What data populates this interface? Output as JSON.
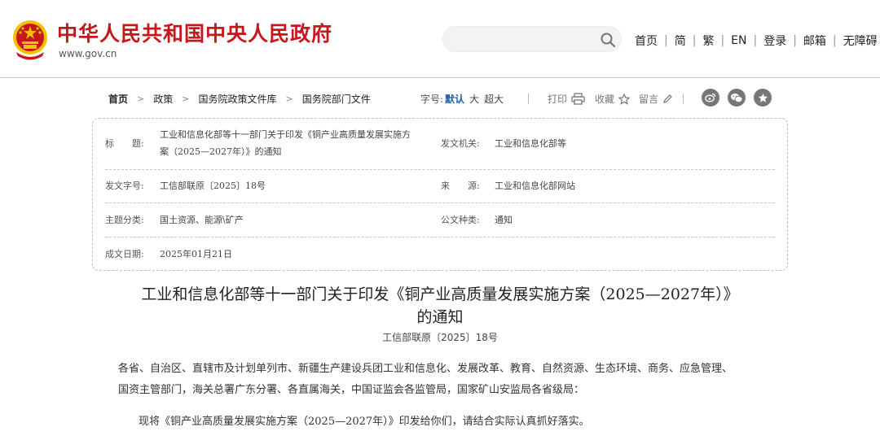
{
  "header": {
    "site_name": "中华人民共和国中央人民政府",
    "site_url": "www.gov.cn",
    "search": {
      "value": "",
      "placeholder": ""
    },
    "links": [
      "首页",
      "简",
      "繁",
      "EN",
      "登录",
      "邮箱",
      "无障碍"
    ]
  },
  "breadcrumb": [
    "首页",
    "政策",
    "国务院政策文件库",
    "国务院部门文件"
  ],
  "font_size": {
    "label": "字号:",
    "active": "默认",
    "options": [
      "大",
      "超大"
    ]
  },
  "tools": {
    "print": "打印",
    "favorite": "收藏",
    "comment": "留言"
  },
  "share_icons": [
    "weibo-icon",
    "wechat-icon",
    "star-icon"
  ],
  "info": {
    "title_label": "标　　题:",
    "title_value_line1": "工业和信息化部等十一部门关于印发《铜产业高质量发展实施方",
    "title_value_line2": "案（2025—2027年）》的通知",
    "issuer_label": "发文机关:",
    "issuer_value": "工业和信息化部等",
    "doc_no_label": "发文字号:",
    "doc_no_value": "工信部联原〔2025〕18号",
    "source_label": "来　　源:",
    "source_value": "工业和信息化部网站",
    "category_label": "主题分类:",
    "category_value": "国土资源、能源\\矿产",
    "doc_type_label": "公文种类:",
    "doc_type_value": "通知",
    "date_label": "成文日期:",
    "date_value": "2025年01月21日"
  },
  "article": {
    "title_line1": "工业和信息化部等十一部门关于印发《铜产业高质量发展实施方案（2025—2027年）》",
    "title_line2": "的通知",
    "doc_no": "工信部联原〔2025〕18号",
    "para1_line1": "各省、自治区、直辖市及计划单列市、新疆生产建设兵团工业和信息化、发展改革、教育、自然资源、生态环境、商务、应急管理、",
    "para1_line2": "国资主管部门，海关总署广东分署、各直属海关，中国证监会各监管局，国家矿山安监局各省级局：",
    "para2": "现将《铜产业高质量发展实施方案（2025—2027年）》印发给你们，请结合实际认真抓好落实。"
  },
  "colors": {
    "brand_red": "#c8161d",
    "emblem_gold": "#f2c200",
    "link_blue": "#1f5fa8"
  }
}
